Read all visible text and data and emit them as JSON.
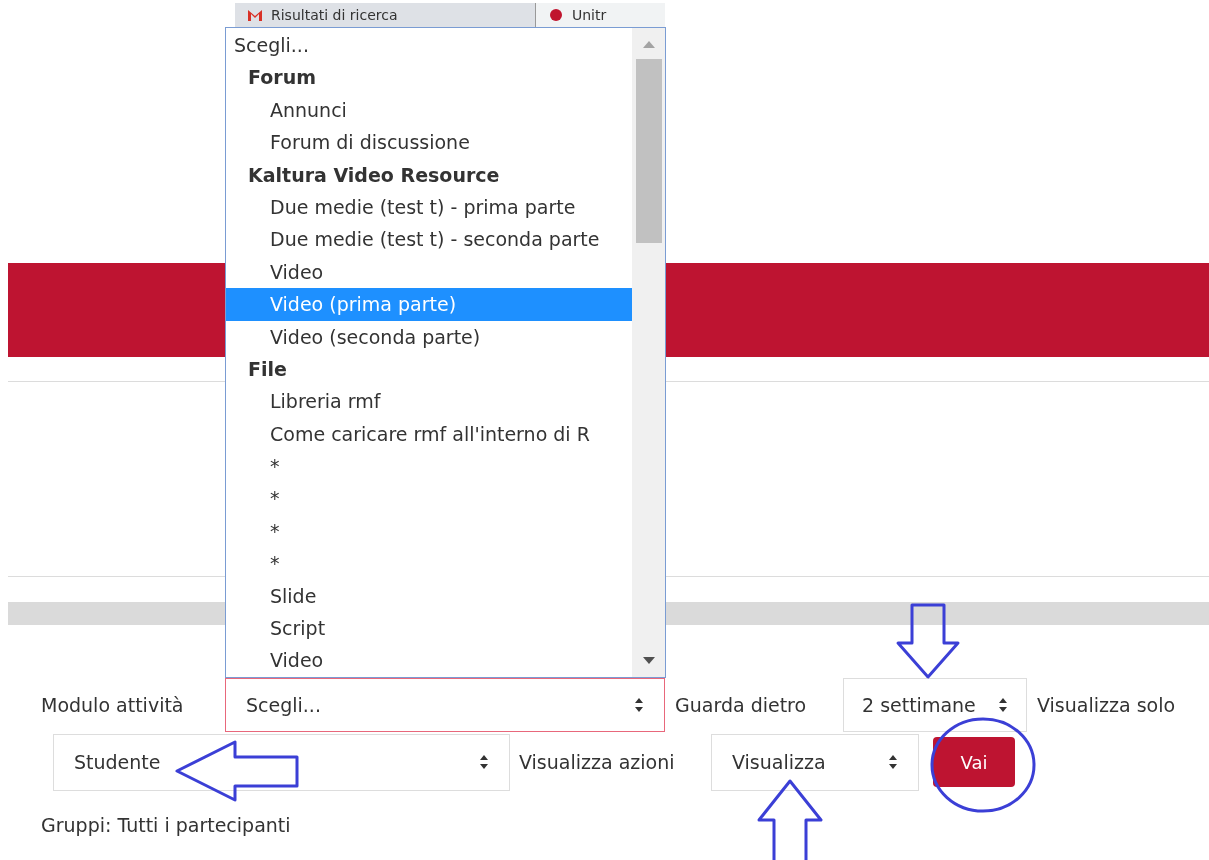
{
  "browser_tabs": [
    {
      "title": "Risultati di ricerca",
      "selected": true
    },
    {
      "title": "Unitr",
      "selected": false
    }
  ],
  "dropdown": {
    "items": [
      {
        "kind": "option",
        "label": "Scegli...",
        "selected": false
      },
      {
        "kind": "group",
        "label": "Forum",
        "children": [
          {
            "kind": "option",
            "label": "Annunci",
            "selected": false
          },
          {
            "kind": "option",
            "label": "Forum di discussione",
            "selected": false
          }
        ]
      },
      {
        "kind": "group",
        "label": "Kaltura Video Resource",
        "children": [
          {
            "kind": "option",
            "label": "Due medie (test t) - prima parte",
            "selected": false
          },
          {
            "kind": "option",
            "label": "Due medie (test t) - seconda parte",
            "selected": false
          },
          {
            "kind": "option",
            "label": "Video",
            "selected": false
          },
          {
            "kind": "option",
            "label": "Video (prima parte)",
            "selected": true
          },
          {
            "kind": "option",
            "label": "Video (seconda parte)",
            "selected": false
          }
        ]
      },
      {
        "kind": "group",
        "label": "File",
        "children": [
          {
            "kind": "option",
            "label": "Libreria rmf",
            "selected": false
          },
          {
            "kind": "option",
            "label": "Come caricare rmf all'interno di R",
            "selected": false
          },
          {
            "kind": "option",
            "label": "*",
            "selected": false
          },
          {
            "kind": "option",
            "label": "*",
            "selected": false
          },
          {
            "kind": "option",
            "label": "*",
            "selected": false
          },
          {
            "kind": "option",
            "label": "*",
            "selected": false
          },
          {
            "kind": "option",
            "label": "Slide",
            "selected": false
          },
          {
            "kind": "option",
            "label": "Script",
            "selected": false
          },
          {
            "kind": "option",
            "label": "Video",
            "selected": false
          }
        ]
      }
    ]
  },
  "filters": {
    "activity_module": {
      "label": "Modulo attività",
      "value": "Scegli..."
    },
    "look_back": {
      "label": "Guarda dietro",
      "value": "2 settimane"
    },
    "show_only": {
      "label": "Visualizza solo",
      "value": "Studente"
    },
    "show_actions": {
      "label": "Visualizza azioni",
      "value": "Visualizza"
    },
    "go_button": "Vai",
    "groups": "Gruppi: Tutti i partecipanti"
  }
}
